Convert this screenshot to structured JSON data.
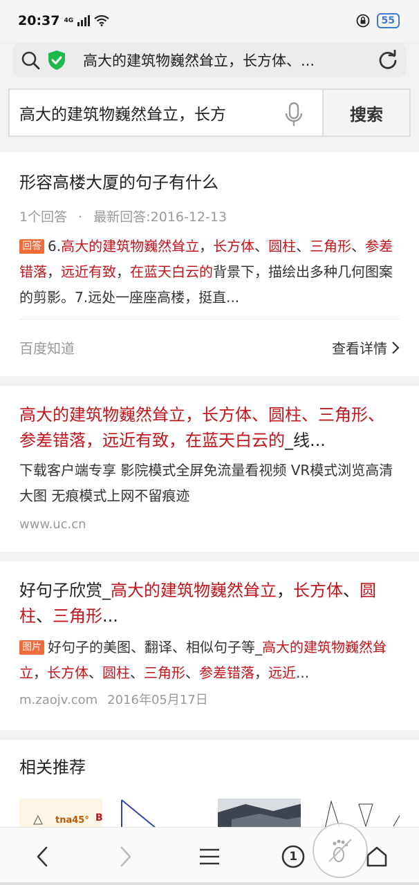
{
  "status": {
    "time": "20:37",
    "network": "4G",
    "battery": "55"
  },
  "url_bar": {
    "text": "高大的建筑物巍然耸立，长方体、..."
  },
  "search": {
    "query": "高大的建筑物巍然耸立，长方",
    "button": "搜索"
  },
  "results": [
    {
      "title": "形容高楼大厦的句子有什么",
      "meta_count": "1个回答",
      "meta_sep": "·",
      "meta_date": "最新回答:2016-12-13",
      "tag": "回答",
      "snippet_a": "6.",
      "snippet_b": "高大的建筑物巍然耸立",
      "snippet_c": "，",
      "snippet_d": "长方体",
      "snippet_e": "、",
      "snippet_f": "圆柱",
      "snippet_g": "、",
      "snippet_h": "三角形",
      "snippet_i": "、",
      "snippet_j": "参差错落",
      "snippet_k": "，",
      "snippet_l": "远近有致",
      "snippet_m": "，",
      "snippet_n": "在蓝天白云的",
      "snippet_o": "背景下，描绘出多种几何图案的剪影。7.远处一座座高楼，挺直...",
      "source": "百度知道",
      "detail": "查看详情"
    },
    {
      "title_red": "高大的建筑物巍然耸立，长方体、圆柱、三角形、参差错落，远近有致，在蓝天白云的",
      "title_tail": "_线...",
      "snippet": "下载客户端专享 影院模式全屏免流量看视频 VR模式浏览高清大图 无痕模式上网不留痕迹",
      "url": "www.uc.cn"
    },
    {
      "title_black": "好句子欣赏_",
      "title_red1": "高大的建筑物巍然耸立",
      "title_c1": "，",
      "title_red2": "长方体",
      "title_c2": "、",
      "title_red3": "圆柱",
      "title_c3": "、",
      "title_red4": "三角形",
      "title_tail": "...",
      "tag": "图片",
      "snippet_a": "好句子的美图、翻译、相似句子等_",
      "snippet_b": "高大的建筑物巍然耸立",
      "snippet_c": "，",
      "snippet_d": "长方体",
      "snippet_e": "、",
      "snippet_f": "圆柱",
      "snippet_g": "、",
      "snippet_h": "三角形",
      "snippet_i": "、",
      "snippet_j": "参差错落",
      "snippet_k": "，",
      "snippet_l": "远近",
      "snippet_m": "...",
      "url": "m.zaojv.com",
      "date": "2016年05月17日"
    }
  ],
  "related": {
    "title": "相关推荐",
    "thumb1_text": "tna45°",
    "thumb1_letter": "B"
  },
  "nav": {
    "tabs_count": "1"
  },
  "colors": {
    "highlight": "#c0151c",
    "tag": "#f26b3a",
    "shield": "#1fb84a"
  }
}
